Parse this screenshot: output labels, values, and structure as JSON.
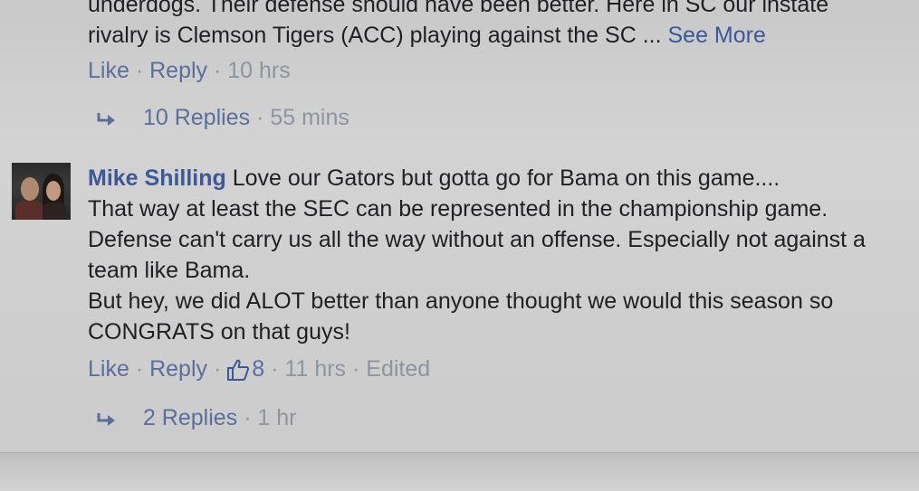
{
  "comment1": {
    "text_line1": "underdogs. Their defense should have been better. Here in SC our instate",
    "text_line2": "rivalry is Clemson Tigers (ACC) playing against the SC ...",
    "see_more": "See More",
    "like": "Like",
    "reply": "Reply",
    "time": "10 hrs",
    "replies_label": "10 Replies",
    "replies_time": "55 mins"
  },
  "comment2": {
    "author": "Mike Shilling",
    "line1": "Love our Gators but gotta go for Bama on this game....",
    "line2": "That way at least the SEC can be represented in the championship game.",
    "line3": "Defense can't carry us all the way without an offense. Especially not against a",
    "line4": "team like Bama.",
    "line5": "But hey, we did ALOT better than anyone thought we would this season so",
    "line6": "CONGRATS on that guys!",
    "like": "Like",
    "reply": "Reply",
    "like_count": "8",
    "time": "11 hrs",
    "edited": "Edited",
    "replies_label": "2 Replies",
    "replies_time": "1 hr"
  },
  "colors": {
    "link": "#3b5998",
    "muted": "#8d95a1",
    "text": "#1f2024"
  },
  "icons": {
    "reply_arrow": "reply-arrow-icon",
    "thumbs_up": "thumbs-up-icon"
  }
}
